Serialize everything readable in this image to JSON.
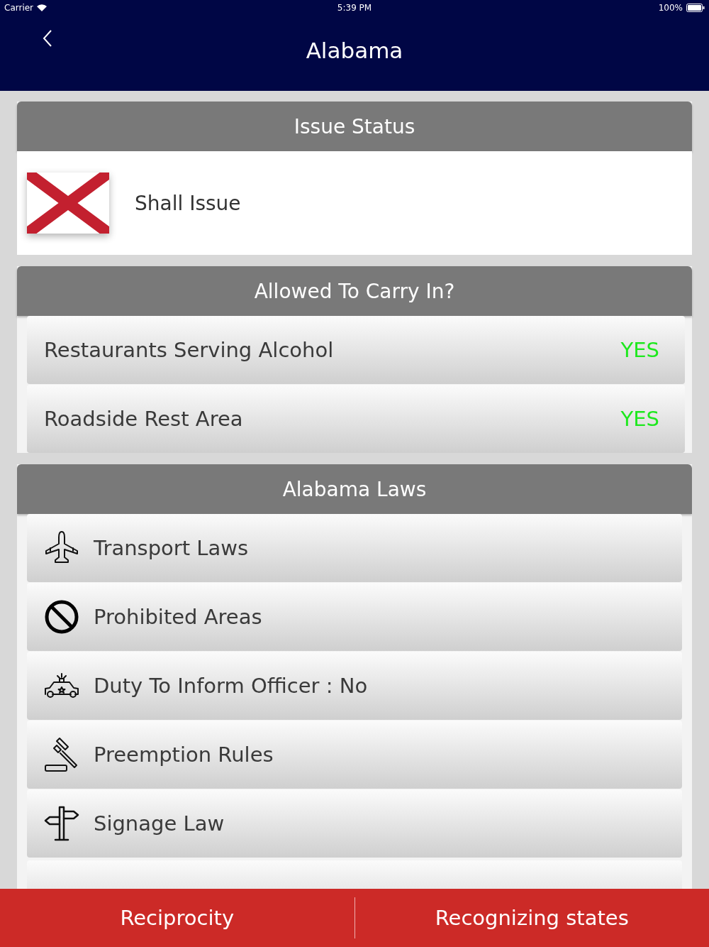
{
  "status_bar": {
    "carrier": "Carrier",
    "time": "5:39 PM",
    "battery": "100%"
  },
  "nav": {
    "title": "Alabama"
  },
  "issue_status": {
    "header": "Issue Status",
    "value": "Shall Issue"
  },
  "allowed": {
    "header": "Allowed To Carry In?",
    "rows": [
      {
        "label": "Restaurants Serving Alcohol",
        "answer": "YES"
      },
      {
        "label": "Roadside Rest Area",
        "answer": "YES"
      }
    ]
  },
  "laws": {
    "header": "Alabama Laws",
    "items": [
      {
        "label": "Transport Laws"
      },
      {
        "label": "Prohibited Areas"
      },
      {
        "label": "Duty To Inform Officer : No"
      },
      {
        "label": "Preemption Rules"
      },
      {
        "label": "Signage Law"
      }
    ]
  },
  "bottom_bar": {
    "buttons": [
      {
        "label": "Reciprocity"
      },
      {
        "label": "Recognizing states"
      }
    ]
  }
}
